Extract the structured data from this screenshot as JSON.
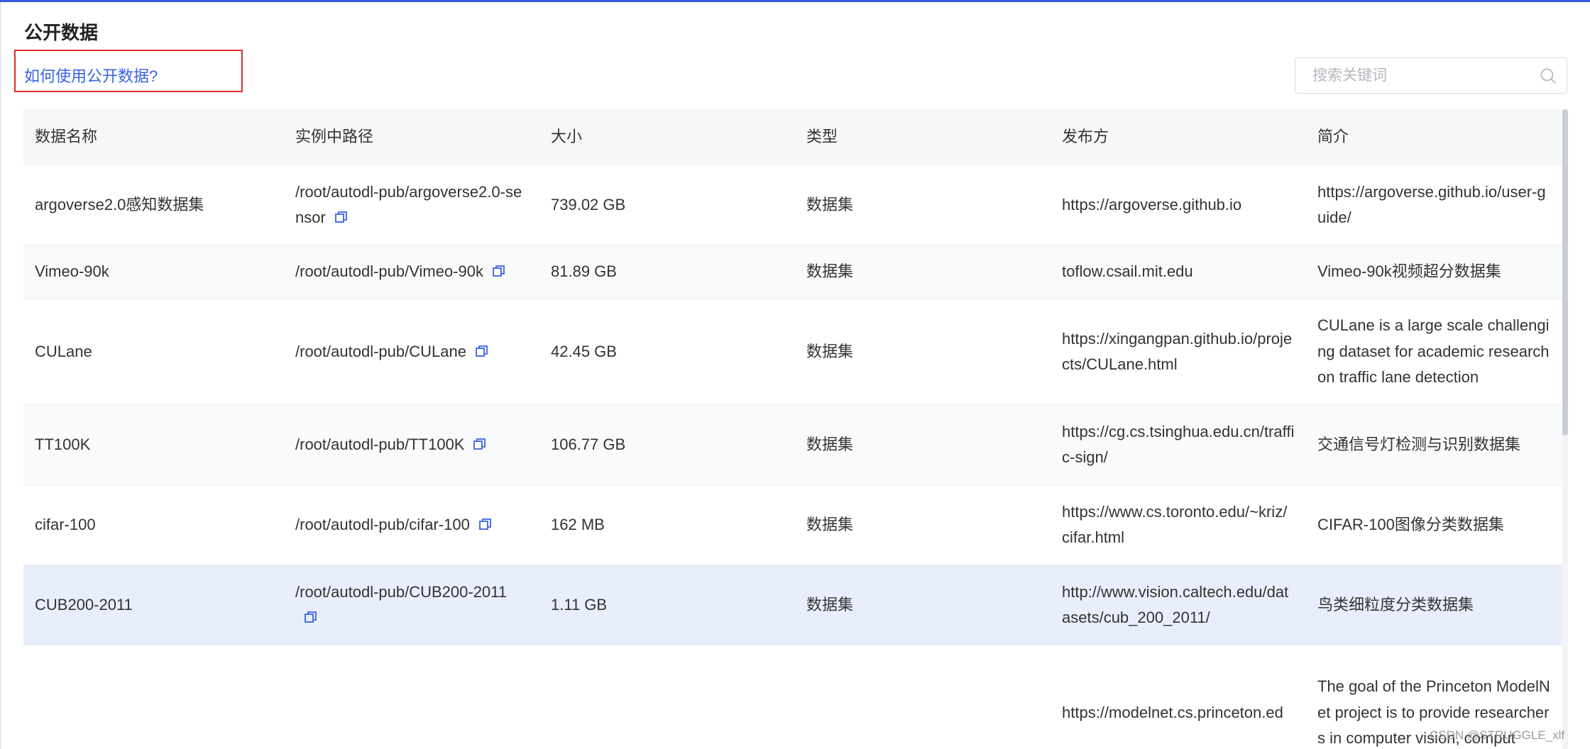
{
  "page": {
    "title": "公开数据",
    "howto_link": "如何使用公开数据?"
  },
  "search": {
    "placeholder": "搜索关键词",
    "icon": "search-icon"
  },
  "table": {
    "headers": [
      "数据名称",
      "实例中路径",
      "大小",
      "类型",
      "发布方",
      "简介"
    ],
    "rows": [
      {
        "name": "argoverse2.0感知数据集",
        "path": "/root/autodl-pub/argoverse2.0-sensor",
        "size": "739.02 GB",
        "type": "数据集",
        "publisher": "https://argoverse.github.io",
        "desc": "https://argoverse.github.io/user-guide/"
      },
      {
        "name": "Vimeo-90k",
        "path": "/root/autodl-pub/Vimeo-90k",
        "size": "81.89 GB",
        "type": "数据集",
        "publisher": "toflow.csail.mit.edu",
        "desc": "Vimeo-90k视频超分数据集"
      },
      {
        "name": "CULane",
        "path": "/root/autodl-pub/CULane",
        "size": "42.45 GB",
        "type": "数据集",
        "publisher": "https://xingangpan.github.io/projects/CULane.html",
        "desc": "CULane is a large scale challenging dataset for academic research on traffic lane detection"
      },
      {
        "name": "TT100K",
        "path": "/root/autodl-pub/TT100K",
        "size": "106.77 GB",
        "type": "数据集",
        "publisher": "https://cg.cs.tsinghua.edu.cn/traffic-sign/",
        "desc": "交通信号灯检测与识别数据集"
      },
      {
        "name": "cifar-100",
        "path": "/root/autodl-pub/cifar-100",
        "size": "162 MB",
        "type": "数据集",
        "publisher": "https://www.cs.toronto.edu/~kriz/cifar.html",
        "desc": "CIFAR-100图像分类数据集"
      },
      {
        "name": "CUB200-2011",
        "path": "/root/autodl-pub/CUB200-2011",
        "size": "1.11 GB",
        "type": "数据集",
        "publisher": "http://www.vision.caltech.edu/datasets/cub_200_2011/",
        "desc": "鸟类细粒度分类数据集"
      },
      {
        "name": "",
        "path": "",
        "size": "",
        "type": "",
        "publisher": "https://modelnet.cs.princeton.ed",
        "desc": "The goal of the Princeton ModelNet project is to provide researchers in computer vision, comput"
      }
    ]
  },
  "watermark": "CSDN @STRUGGLE_xlf",
  "colors": {
    "accent": "#3a63e6",
    "highlight_row": "#e9eefc",
    "annotation_box": "#e02d2d"
  }
}
